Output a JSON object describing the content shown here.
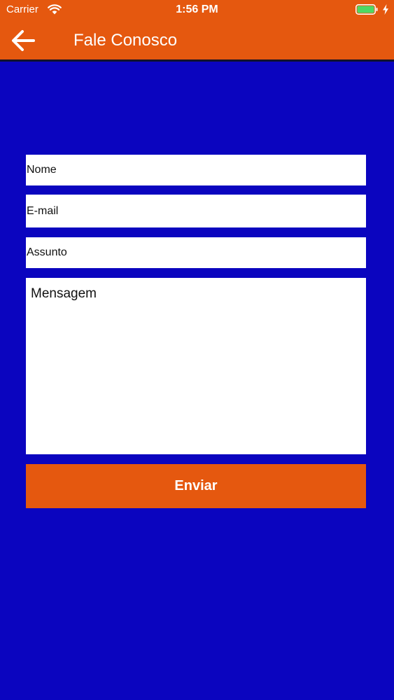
{
  "status_bar": {
    "carrier": "Carrier",
    "time": "1:56 PM",
    "wifi_icon": "wifi-icon",
    "battery_icon": "battery-icon",
    "charging_icon": "bolt-icon",
    "battery_level": 1.0
  },
  "nav": {
    "back_icon": "arrow-left-icon",
    "title": "Fale Conosco"
  },
  "form": {
    "name_placeholder": "Nome",
    "email_placeholder": "E-mail",
    "subject_placeholder": "Assunto",
    "message_placeholder": "Mensagem",
    "send_label": "Enviar"
  },
  "colors": {
    "primary": "#E5580F",
    "background": "#0B05BF",
    "field_background": "#FFFFFF",
    "battery": "#4CD964"
  }
}
